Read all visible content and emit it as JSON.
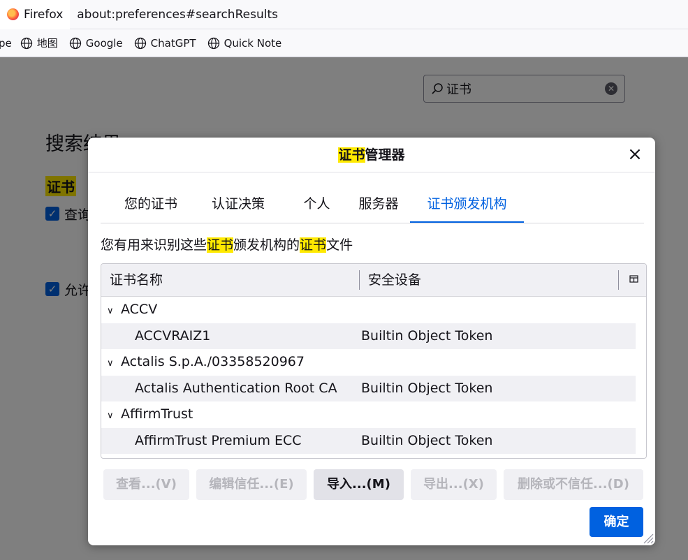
{
  "browser": {
    "identity_label": "Firefox",
    "url": "about:preferences#searchResults",
    "bookmarks": [
      "pe",
      "地图",
      "Google",
      "ChatGPT",
      "Quick Note"
    ]
  },
  "preferences": {
    "search_value": "证书",
    "results_title": "搜索结果",
    "category_heading": "证书",
    "checkbox_1_label": "查询",
    "checkbox_2_label": "允许"
  },
  "dialog": {
    "title_highlight": "证书",
    "title_rest": "管理器",
    "tabs": [
      {
        "label": "您的证书"
      },
      {
        "label": "认证决策"
      },
      {
        "label": "个人"
      },
      {
        "label": "服务器"
      },
      {
        "label": "证书颁发机构",
        "selected": true
      }
    ],
    "description": {
      "part1": "您有用来识别这些",
      "hl1": "证书",
      "part2": "颁发机构的",
      "hl2": "证书",
      "part3": "文件"
    },
    "columns": {
      "name": "证书名称",
      "device": "安全设备"
    },
    "groups": [
      {
        "name": "ACCV",
        "children": [
          {
            "name": "ACCVRAIZ1",
            "device": "Builtin Object Token"
          }
        ]
      },
      {
        "name": "Actalis S.p.A./03358520967",
        "children": [
          {
            "name": "Actalis Authentication Root CA",
            "device": "Builtin Object Token"
          }
        ]
      },
      {
        "name": "AffirmTrust",
        "children": [
          {
            "name": "AffirmTrust Premium ECC",
            "device": "Builtin Object Token"
          }
        ]
      }
    ],
    "buttons": {
      "view": "查看...(V)",
      "edit_trust": "编辑信任...(E)",
      "import": "导入...(M)",
      "export": "导出...(X)",
      "delete": "删除或不信任...(D)",
      "ok": "确定"
    }
  },
  "colors": {
    "accent": "#0061e0",
    "highlight": "#ffe900"
  }
}
